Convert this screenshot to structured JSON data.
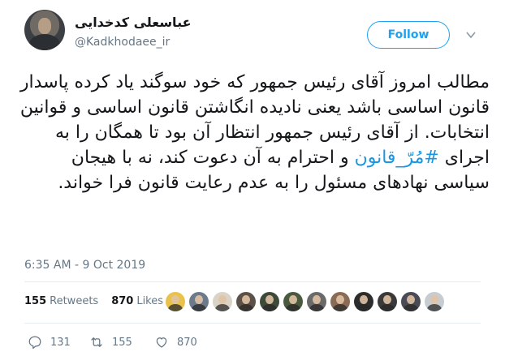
{
  "author": {
    "name": "عباسعلی کدخدایی",
    "handle": "@Kadkhodaee_ir"
  },
  "follow_label": "Follow",
  "tweet": {
    "text_before": "مطالب امروز آقای رئیس جمهور که خود سوگند یاد کرده پاسدار قانون اساسی باشد یعنی نادیده انگاشتن قانون اساسی و قوانین انتخابات. از آقای رئیس جمهور انتظار آن بود تا همگان را به اجرای ",
    "hashtag": "#مُرّ_قانون",
    "text_after": " و احترام به آن دعوت کند، نه با هیجان سیاسی نهادهای مسئول را به عدم رعایت قانون فرا خواند."
  },
  "timestamp": "6:35 AM - 9 Oct 2019",
  "stats": {
    "retweets_count": "155",
    "retweets_label": "Retweets",
    "likes_count": "870",
    "likes_label": "Likes"
  },
  "liker_avatars": [
    "#e8c24a",
    "#6b7b8c",
    "#d9d4c7",
    "#5b5148",
    "#3d4a3a",
    "#4a5a3f",
    "#6a6a6a",
    "#8a6b55",
    "#2d2d2d",
    "#3a3a3a",
    "#4b4b55",
    "#c7ccd1"
  ],
  "actions": {
    "reply_count": "131",
    "retweet_count": "155",
    "like_count": "870"
  },
  "colors": {
    "accent": "#1da1f2",
    "hashtag": "#1b95e0",
    "muted": "#657786"
  }
}
